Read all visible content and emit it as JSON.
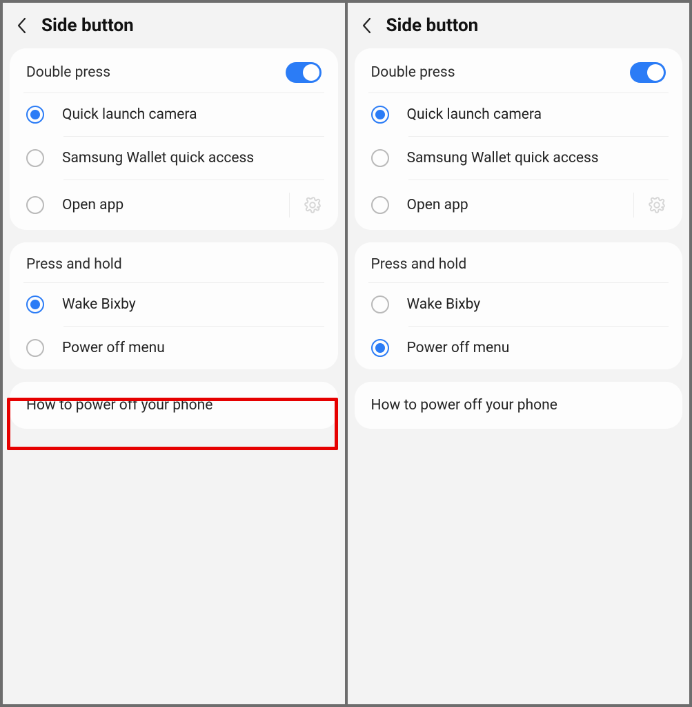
{
  "left": {
    "title": "Side button",
    "doublePress": {
      "header": "Double press",
      "toggle": true,
      "options": [
        {
          "label": "Quick launch camera",
          "selected": true,
          "gear": false
        },
        {
          "label": "Samsung Wallet quick access",
          "selected": false,
          "gear": false
        },
        {
          "label": "Open app",
          "selected": false,
          "gear": true
        }
      ]
    },
    "pressHold": {
      "header": "Press and hold",
      "options": [
        {
          "label": "Wake Bixby",
          "selected": true
        },
        {
          "label": "Power off menu",
          "selected": false,
          "highlighted": true
        }
      ]
    },
    "footerLink": "How to power off your phone"
  },
  "right": {
    "title": "Side button",
    "doublePress": {
      "header": "Double press",
      "toggle": true,
      "options": [
        {
          "label": "Quick launch camera",
          "selected": true,
          "gear": false
        },
        {
          "label": "Samsung Wallet quick access",
          "selected": false,
          "gear": false
        },
        {
          "label": "Open app",
          "selected": false,
          "gear": true
        }
      ]
    },
    "pressHold": {
      "header": "Press and hold",
      "options": [
        {
          "label": "Wake Bixby",
          "selected": false
        },
        {
          "label": "Power off menu",
          "selected": true
        }
      ]
    },
    "footerLink": "How to power off your phone"
  }
}
